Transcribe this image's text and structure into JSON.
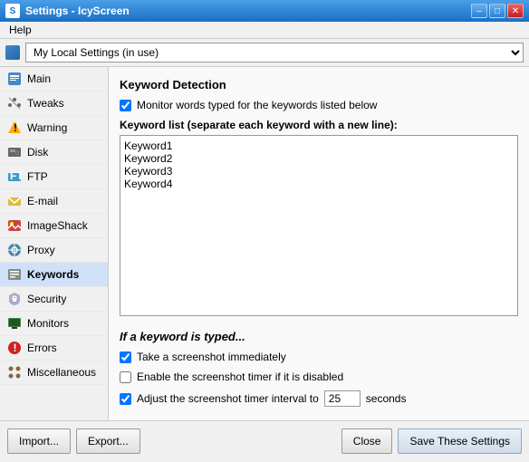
{
  "window": {
    "title": "Settings - IcyScreen",
    "icon": "S"
  },
  "title_buttons": {
    "minimize": "–",
    "maximize": "□",
    "close": "✕"
  },
  "menu": {
    "items": [
      "Help"
    ]
  },
  "toolbar": {
    "profile": "My Local Settings (in use)",
    "dropdown_arrow": "▼"
  },
  "sidebar": {
    "items": [
      {
        "id": "main",
        "label": "Main",
        "icon": "main"
      },
      {
        "id": "tweaks",
        "label": "Tweaks",
        "icon": "tweaks"
      },
      {
        "id": "warning",
        "label": "Warning",
        "icon": "warning"
      },
      {
        "id": "disk",
        "label": "Disk",
        "icon": "disk"
      },
      {
        "id": "ftp",
        "label": "FTP",
        "icon": "ftp"
      },
      {
        "id": "email",
        "label": "E-mail",
        "icon": "email"
      },
      {
        "id": "imageshack",
        "label": "ImageShack",
        "icon": "imageshack"
      },
      {
        "id": "proxy",
        "label": "Proxy",
        "icon": "proxy"
      },
      {
        "id": "keywords",
        "label": "Keywords",
        "icon": "keywords",
        "active": true
      },
      {
        "id": "security",
        "label": "Security",
        "icon": "security"
      },
      {
        "id": "monitors",
        "label": "Monitors",
        "icon": "monitors"
      },
      {
        "id": "errors",
        "label": "Errors",
        "icon": "errors"
      },
      {
        "id": "miscellaneous",
        "label": "Miscellaneous",
        "icon": "misc"
      }
    ]
  },
  "content": {
    "section_title": "Keyword Detection",
    "monitor_label": "Monitor words typed for the keywords listed below",
    "monitor_checked": true,
    "keyword_list_label": "Keyword list (separate each keyword with a new line):",
    "keywords": [
      "Keyword1",
      "Keyword2",
      "Keyword3",
      "Keyword4"
    ],
    "trigger_title": "If a keyword is typed...",
    "options": [
      {
        "id": "screenshot_immediate",
        "label": "Take a screenshot immediately",
        "checked": true
      },
      {
        "id": "screenshot_timer",
        "label": "Enable the screenshot timer if it is disabled",
        "checked": false
      },
      {
        "id": "adjust_interval",
        "label": "Adjust the screenshot timer interval to",
        "checked": true
      }
    ],
    "interval_value": "25",
    "seconds_label": "seconds"
  },
  "bottom_buttons": {
    "import": "Import...",
    "export": "Export...",
    "close": "Close",
    "save": "Save These Settings"
  }
}
